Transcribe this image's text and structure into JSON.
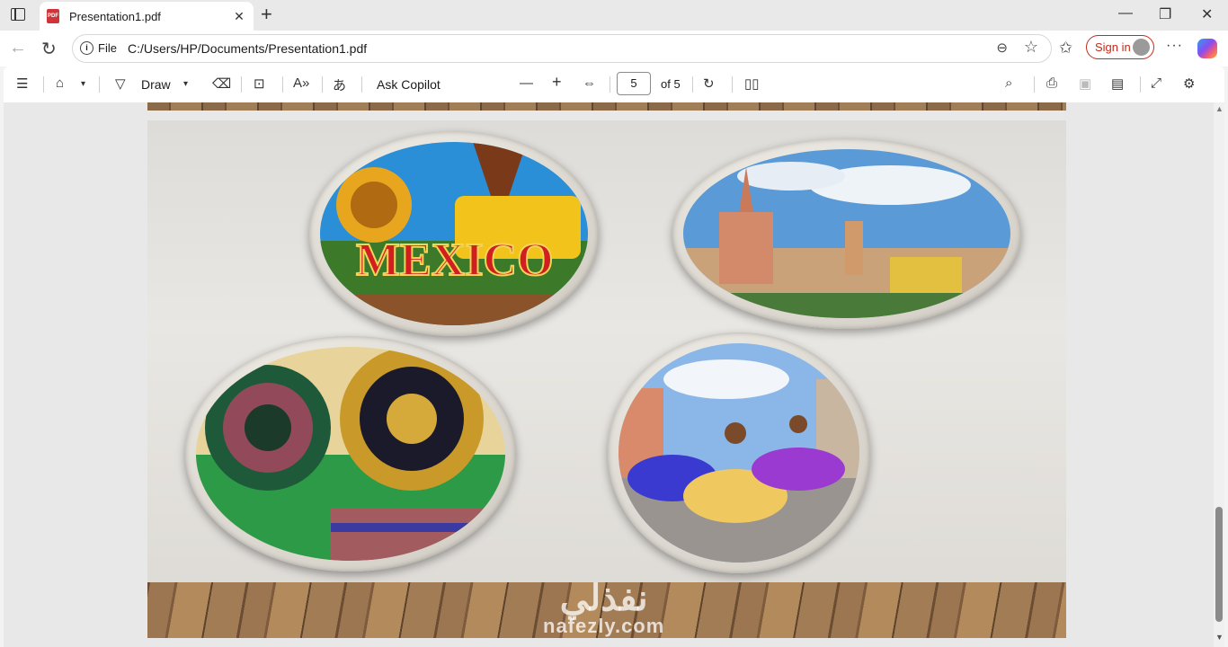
{
  "browser": {
    "tab_title": "Presentation1.pdf",
    "tab_icon_text": "PDF",
    "tab_close_glyph": "✕",
    "new_tab_glyph": "+",
    "window_controls": [
      "—",
      "❐",
      "✕"
    ],
    "address_scheme_label": "File",
    "address_url": "C:/Users/HP/Documents/Presentation1.pdf",
    "sign_in_label": "Sign in",
    "more_glyph": "···"
  },
  "pdf_toolbar": {
    "draw_label": "Draw",
    "copilot_label": "Ask Copilot",
    "zoom_out_glyph": "—",
    "zoom_in_glyph": "+",
    "current_page": "5",
    "page_total_label": "of 5"
  },
  "slide": {
    "images": [
      "mexico-sign-photo",
      "cathedral-photo",
      "sombreros-photo",
      "folk-dancers-photo"
    ],
    "watermark_arabic": "نفذلي",
    "watermark_latin": "nafezly.com"
  },
  "colors": {
    "accent": "#c42b1c",
    "viewer_bg": "#e8e8e8"
  }
}
